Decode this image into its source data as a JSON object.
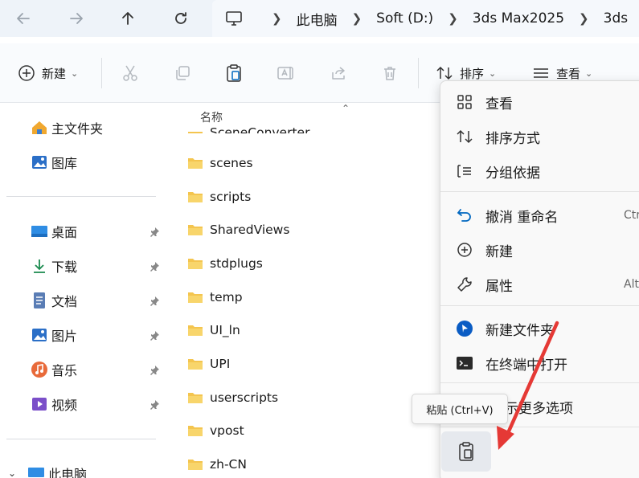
{
  "address": {
    "crumbs": [
      "此电脑",
      "Soft (D:)",
      "3ds Max2025",
      "3ds"
    ]
  },
  "toolbar": {
    "new_label": "新建",
    "sort_label": "排序",
    "view_label": "查看"
  },
  "sidebar": {
    "top_items": [
      {
        "label": "主文件夹"
      },
      {
        "label": "图库"
      }
    ],
    "pinned_items": [
      {
        "label": "桌面"
      },
      {
        "label": "下载"
      },
      {
        "label": "文档"
      },
      {
        "label": "图片"
      },
      {
        "label": "音乐"
      },
      {
        "label": "视频"
      }
    ],
    "bottom_item": "此电脑"
  },
  "filelist": {
    "column_name": "名称",
    "partial_top": "SceneConverter",
    "files": [
      "scenes",
      "scripts",
      "SharedViews",
      "stdplugs",
      "temp",
      "UI_ln",
      "UPI",
      "userscripts",
      "vpost",
      "zh-CN"
    ]
  },
  "context_menu": {
    "items": [
      {
        "label": "查看"
      },
      {
        "label": "排序方式"
      },
      {
        "label": "分组依据"
      },
      {
        "label": "撤消 重命名",
        "shortcut": "Ctr"
      },
      {
        "label": "新建"
      },
      {
        "label": "属性",
        "shortcut": "Alt"
      },
      {
        "label": "新建文件夹"
      },
      {
        "label": "在终端中打开"
      },
      {
        "label": "示更多选项"
      }
    ],
    "tooltip": "粘贴 (Ctrl+V)"
  },
  "colors": {
    "accent": "#0067c0",
    "folder": "#f4c54f",
    "arrow": "#e53935"
  }
}
